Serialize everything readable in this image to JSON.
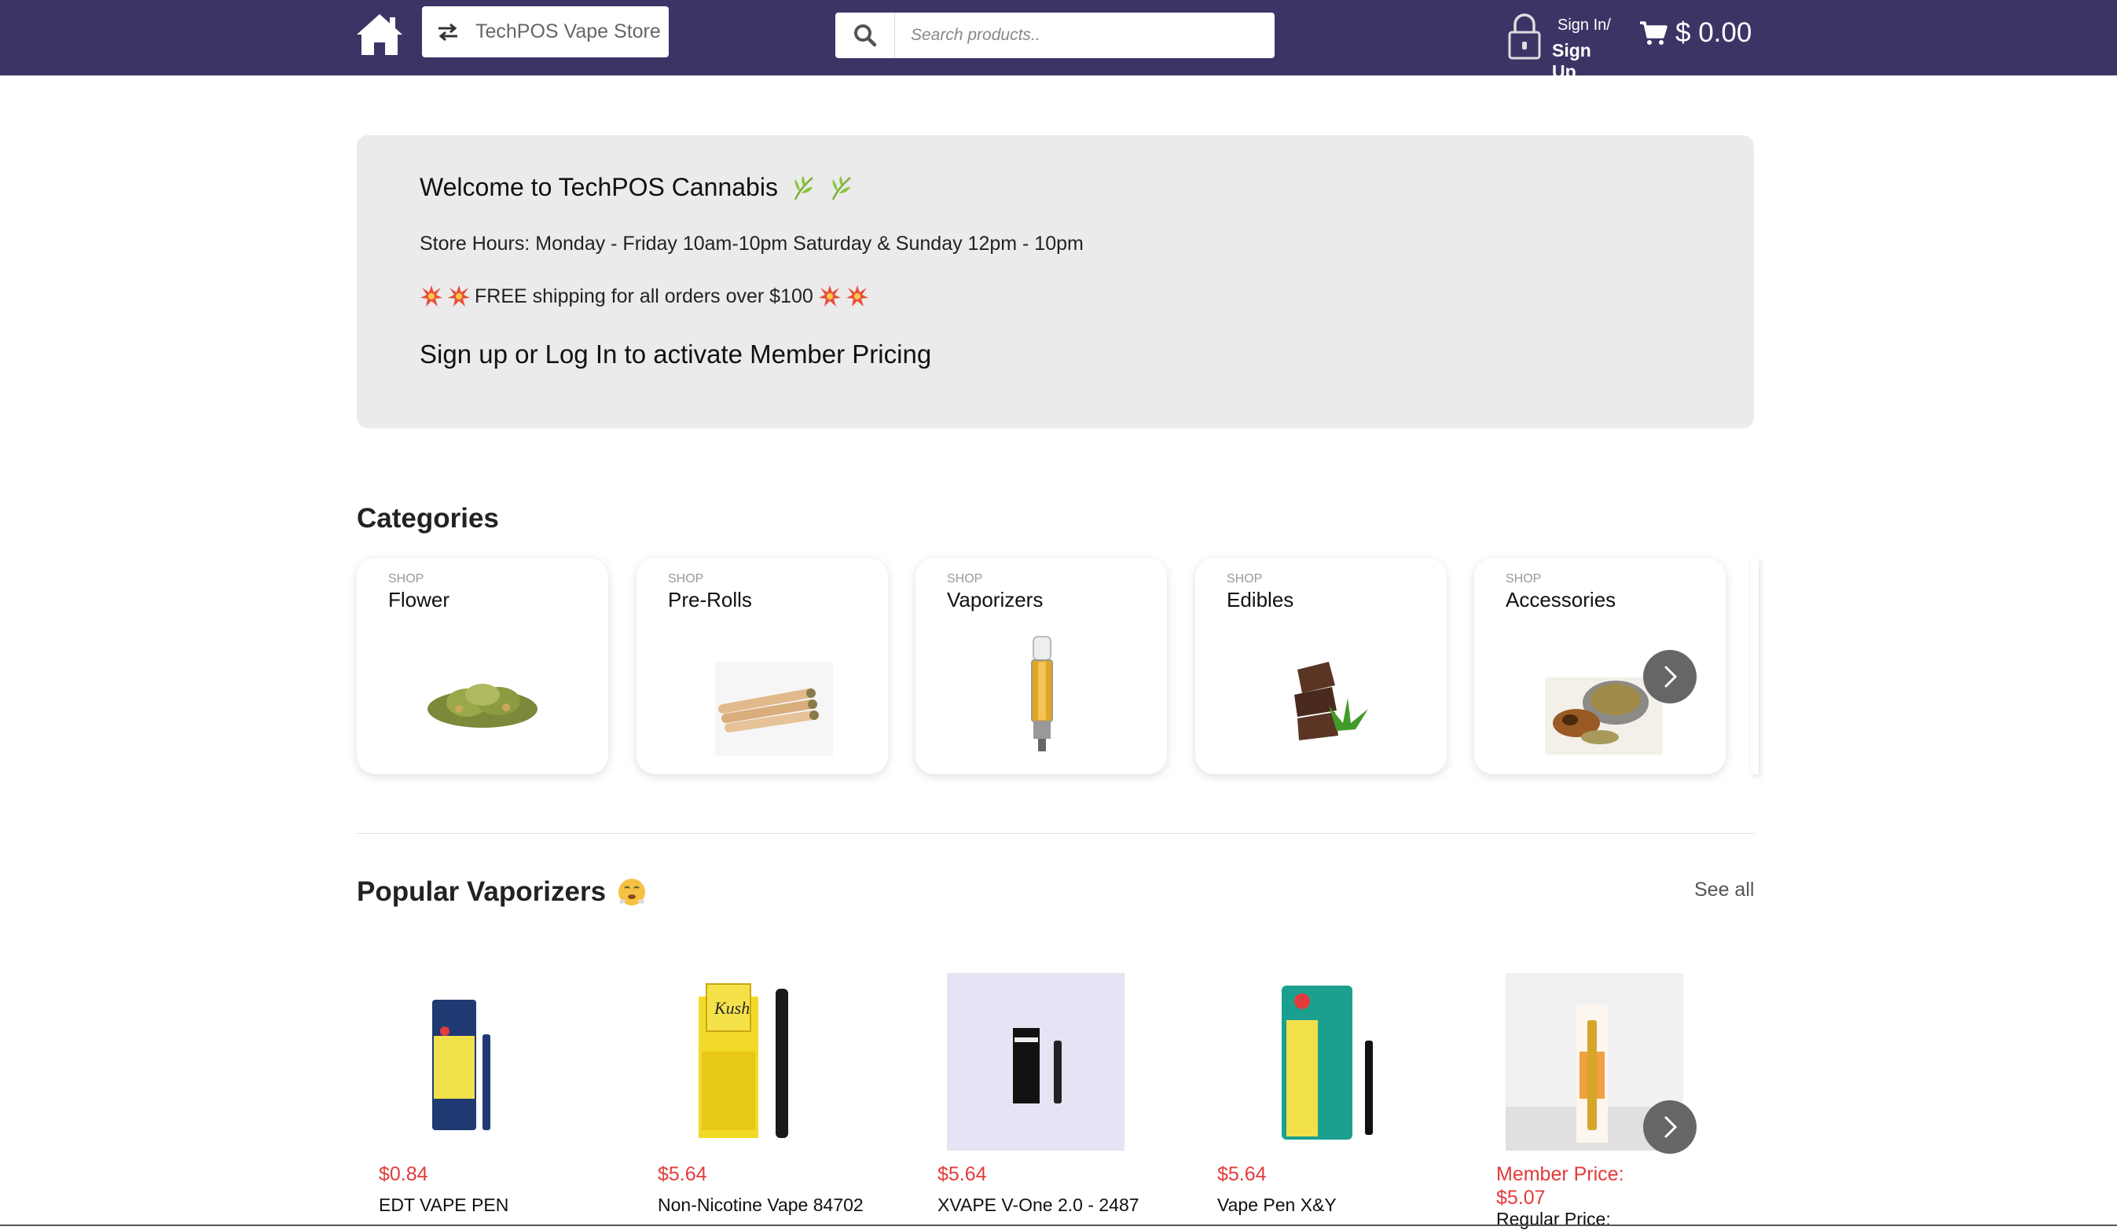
{
  "header": {
    "store_name": "TechPOS Vape Store",
    "search_placeholder": "Search products..",
    "sign_in": "Sign In/",
    "sign_up": "Sign Up",
    "cart_total": "$ 0.00",
    "colors": {
      "bar": "#3d3466"
    }
  },
  "welcome": {
    "title": "Welcome to TechPOS Cannabis",
    "hours": "Store Hours: Monday - Friday 10am-10pm Saturday & Sunday 12pm - 10pm",
    "shipping": "FREE shipping for all orders over $100",
    "member": "Sign up or Log In to activate Member Pricing"
  },
  "categories": {
    "heading": "Categories",
    "items": [
      {
        "shop": "SHOP",
        "name": "Flower",
        "icon": "flower-image"
      },
      {
        "shop": "SHOP",
        "name": "Pre-Rolls",
        "icon": "pre-rolls-image"
      },
      {
        "shop": "SHOP",
        "name": "Vaporizers",
        "icon": "vape-cartridge-image"
      },
      {
        "shop": "SHOP",
        "name": "Edibles",
        "icon": "chocolate-image"
      },
      {
        "shop": "SHOP",
        "name": "Accessories",
        "icon": "grinder-image"
      }
    ]
  },
  "popular": {
    "heading": "Popular Vaporizers",
    "see_all": "See all",
    "products": [
      {
        "price": "$0.84",
        "name": "EDT VAPE PEN"
      },
      {
        "price": "$5.64",
        "name": "Non-Nicotine Vape 84702"
      },
      {
        "price": "$5.64",
        "name": "XVAPE V-One 2.0 - 2487"
      },
      {
        "price": "$5.64",
        "name": "Vape Pen X&Y"
      },
      {
        "member_label": "Member Price:",
        "member_price": "$5.07",
        "regular_label": "Regular Price:"
      }
    ],
    "price_color": "#e23b3b"
  }
}
